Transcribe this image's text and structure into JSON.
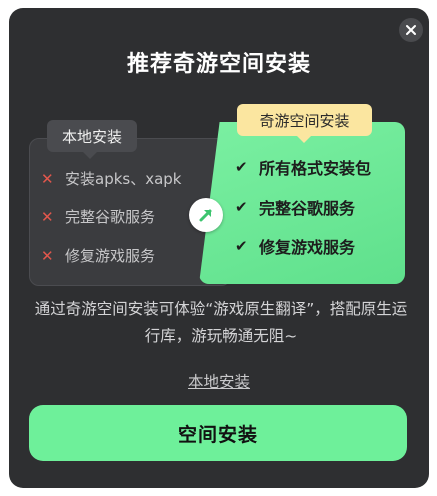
{
  "dialog": {
    "title": "推荐奇游空间安装",
    "close_icon": "close-icon",
    "colors": {
      "background": "#2e2f31",
      "accent_green": "#6ef09a",
      "tag_yellow": "#fbe6a0",
      "cross_red": "#e2574c"
    }
  },
  "comparison": {
    "local": {
      "tag": "本地安装",
      "items": [
        {
          "icon": "cross-icon",
          "label": "安装apks、xapk"
        },
        {
          "icon": "cross-icon",
          "label": "完整谷歌服务"
        },
        {
          "icon": "cross-icon",
          "label": "修复游戏服务"
        }
      ]
    },
    "space": {
      "tag": "奇游空间安装",
      "items": [
        {
          "icon": "check-icon",
          "label": "所有格式安装包"
        },
        {
          "icon": "check-icon",
          "label": "完整谷歌服务"
        },
        {
          "icon": "check-icon",
          "label": "修复游戏服务"
        }
      ]
    },
    "upgrade_icon": "upgrade-arrow-icon"
  },
  "description": "通过奇游空间安装可体验“游戏原生翻译”，搭配原生运行库，游玩畅通无阻~",
  "actions": {
    "local_install_link": "本地安装",
    "space_install_button": "空间安装"
  }
}
